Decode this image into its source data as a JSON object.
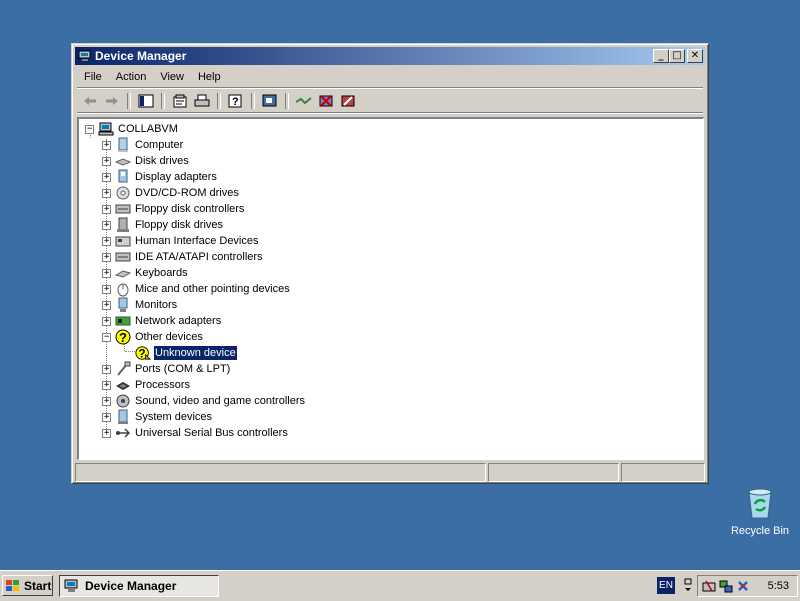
{
  "window": {
    "title": "Device Manager",
    "caption_buttons": {
      "minimize": "_",
      "maximize": "□",
      "close": "✕"
    }
  },
  "menu": [
    "File",
    "Action",
    "View",
    "Help"
  ],
  "toolbar": {
    "icons": [
      "back-arrow-icon",
      "forward-arrow-icon",
      "show-hide-console-tree-icon",
      "properties-icon",
      "print-icon",
      "help-icon",
      "scan-hardware-icon",
      "update-driver-icon",
      "uninstall-icon",
      "disable-icon"
    ]
  },
  "tree": {
    "root": "COLLABVM",
    "categories": [
      {
        "label": "Computer",
        "icon": "computer-icon"
      },
      {
        "label": "Disk drives",
        "icon": "disk-drive-icon"
      },
      {
        "label": "Display adapters",
        "icon": "display-adapter-icon"
      },
      {
        "label": "DVD/CD-ROM drives",
        "icon": "cdrom-icon"
      },
      {
        "label": "Floppy disk controllers",
        "icon": "controller-icon"
      },
      {
        "label": "Floppy disk drives",
        "icon": "floppy-drive-icon"
      },
      {
        "label": "Human Interface Devices",
        "icon": "hid-icon"
      },
      {
        "label": "IDE ATA/ATAPI controllers",
        "icon": "controller-icon"
      },
      {
        "label": "Keyboards",
        "icon": "keyboard-icon"
      },
      {
        "label": "Mice and other pointing devices",
        "icon": "mouse-icon"
      },
      {
        "label": "Monitors",
        "icon": "monitor-icon"
      },
      {
        "label": "Network adapters",
        "icon": "network-adapter-icon"
      },
      {
        "label": "Other devices",
        "icon": "unknown-device-icon",
        "expanded": true,
        "children": [
          "Unknown device"
        ]
      },
      {
        "label": "Ports (COM & LPT)",
        "icon": "port-icon"
      },
      {
        "label": "Processors",
        "icon": "processor-icon"
      },
      {
        "label": "Sound, video and game controllers",
        "icon": "sound-icon"
      },
      {
        "label": "System devices",
        "icon": "system-device-icon"
      },
      {
        "label": "Universal Serial Bus controllers",
        "icon": "usb-icon"
      }
    ],
    "selected": "Unknown device"
  },
  "desktop": {
    "recycle_bin": "Recycle Bin"
  },
  "taskbar": {
    "start": "Start",
    "task": "Device Manager",
    "language": "EN",
    "clock": "5:53"
  }
}
